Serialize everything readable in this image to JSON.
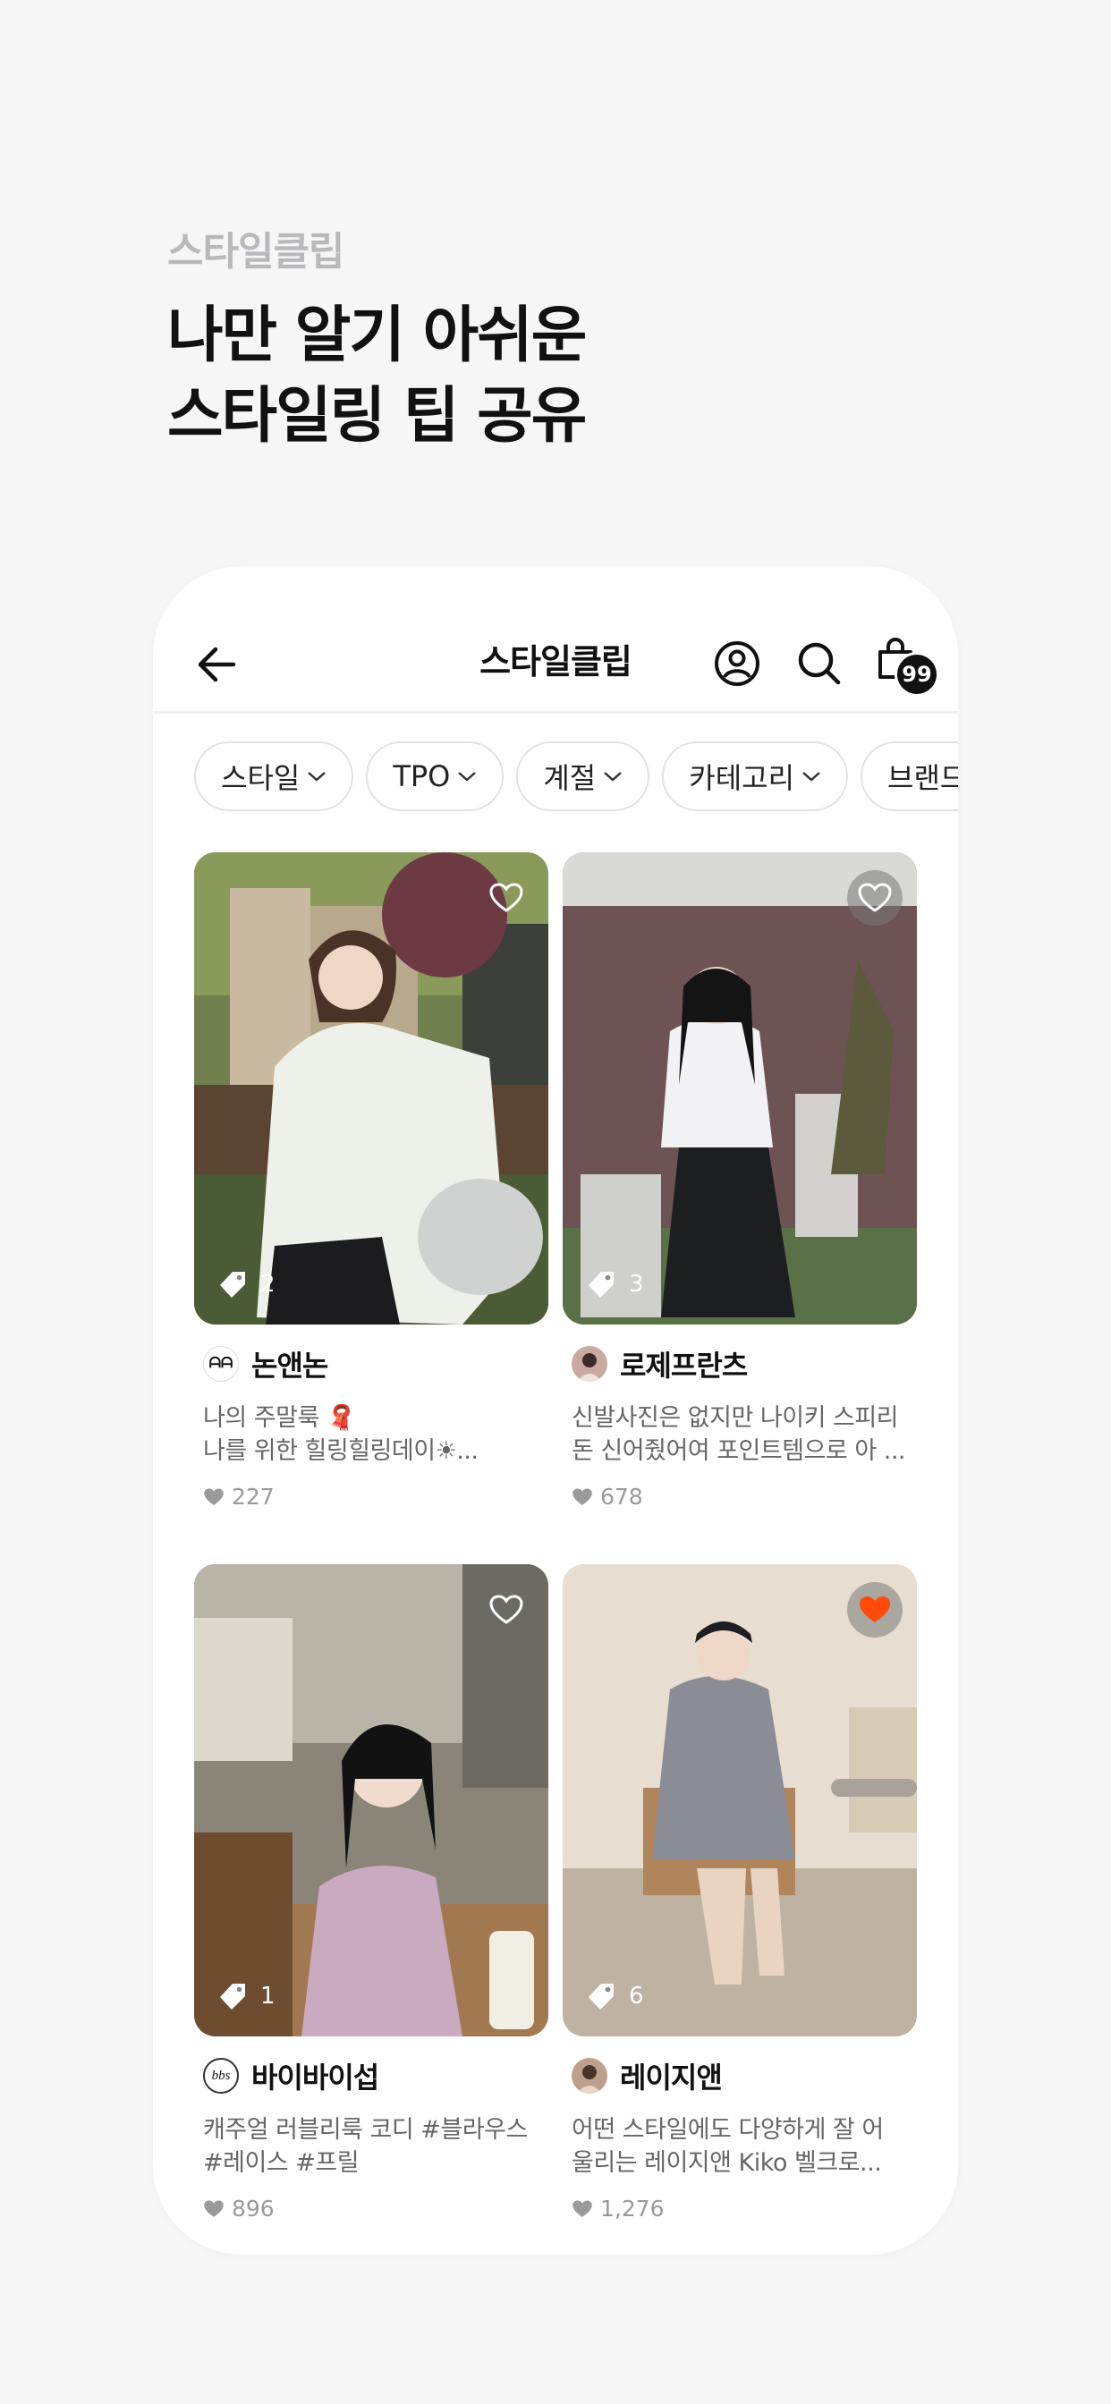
{
  "promo": {
    "eyebrow": "스타일클립",
    "headline_line1": "나만 알기 아쉬운",
    "headline_line2": "스타일링 팁 공유"
  },
  "header": {
    "back_icon": "arrow-left-icon",
    "title": "스타일클립",
    "profile_icon": "user-circle-icon",
    "search_icon": "search-icon",
    "bag_icon": "shopping-bag-icon",
    "bag_badge": "99"
  },
  "filters": [
    "스타일",
    "TPO",
    "계절",
    "카테고리",
    "브랜드"
  ],
  "colors": {
    "accent_like": "#ff4a0a",
    "badge": "#111111"
  },
  "cards": [
    {
      "author": "논앤논",
      "desc_line1": "나의 주말룩 🧣",
      "desc_line2": "나를 위한 힐링힐링데이☀...",
      "likes": "227",
      "tag_count": "2",
      "liked": false
    },
    {
      "author": "로제프란츠",
      "desc_line1": "신발사진은 없지만 나이키 스피리",
      "desc_line2": "돈 신어줬어여 포인트템으로 아 ...",
      "likes": "678",
      "tag_count": "3",
      "liked": false
    },
    {
      "author": "바이바이섭",
      "desc_line1": "캐주얼 러블리룩 코디 #블라우스",
      "desc_line2": "#레이스 #프릴",
      "likes": "896",
      "tag_count": "1",
      "liked": false
    },
    {
      "author": "레이지앤",
      "desc_line1": "어떤 스타일에도 다양하게 잘 어",
      "desc_line2": "울리는 레이지앤 Kiko 벨크로...",
      "likes": "1,276",
      "tag_count": "6",
      "liked": true
    }
  ]
}
